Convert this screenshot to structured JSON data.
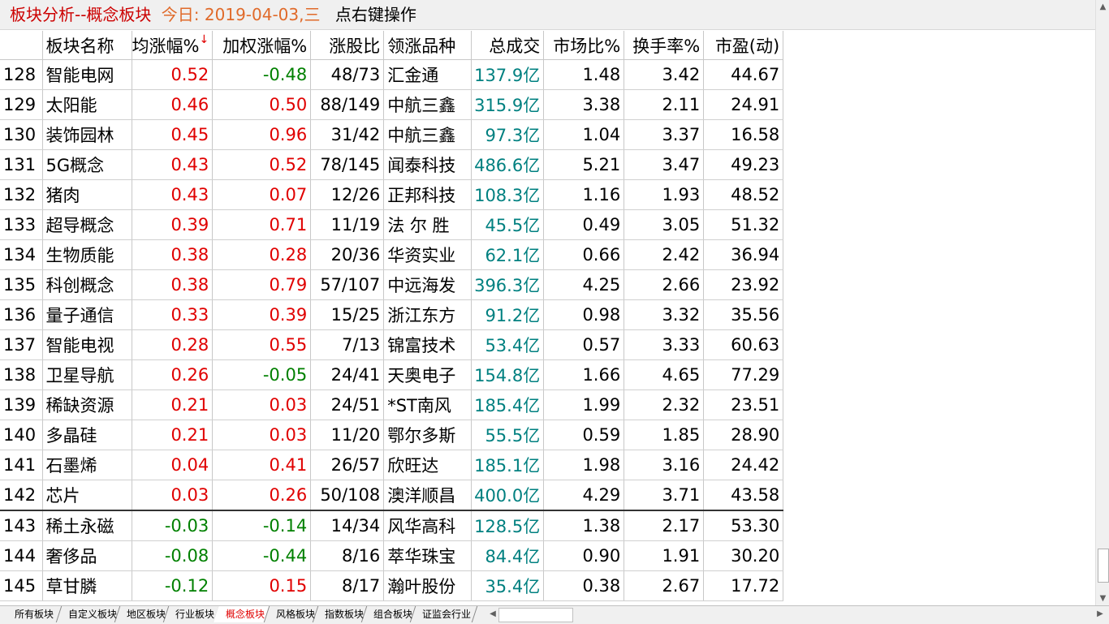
{
  "title": {
    "name": "板块分析--概念板块",
    "date": "今日: 2019-04-03,三",
    "hint": "点右键操作"
  },
  "columns": [
    "",
    "板块名称",
    "均涨幅%",
    "加权涨幅%",
    "涨股比",
    "领涨品种",
    "总成交",
    "市场比%",
    "换手率%",
    "市盈(动)"
  ],
  "sort_arrow": "↓",
  "rows": [
    {
      "idx": "128",
      "name": "智能电网",
      "avg": "0.52",
      "w": "-0.48",
      "ratio": "48/73",
      "lead": "汇金通",
      "vol": "137.9亿",
      "mkt": "1.48",
      "turn": "3.42",
      "pe": "44.67"
    },
    {
      "idx": "129",
      "name": "太阳能",
      "avg": "0.46",
      "w": "0.50",
      "ratio": "88/149",
      "lead": "中航三鑫",
      "vol": "315.9亿",
      "mkt": "3.38",
      "turn": "2.11",
      "pe": "24.91"
    },
    {
      "idx": "130",
      "name": "装饰园林",
      "avg": "0.45",
      "w": "0.96",
      "ratio": "31/42",
      "lead": "中航三鑫",
      "vol": "97.3亿",
      "mkt": "1.04",
      "turn": "3.37",
      "pe": "16.58"
    },
    {
      "idx": "131",
      "name": "5G概念",
      "avg": "0.43",
      "w": "0.52",
      "ratio": "78/145",
      "lead": "闻泰科技",
      "vol": "486.6亿",
      "mkt": "5.21",
      "turn": "3.47",
      "pe": "49.23"
    },
    {
      "idx": "132",
      "name": "猪肉",
      "avg": "0.43",
      "w": "0.07",
      "ratio": "12/26",
      "lead": "正邦科技",
      "vol": "108.3亿",
      "mkt": "1.16",
      "turn": "1.93",
      "pe": "48.52"
    },
    {
      "idx": "133",
      "name": "超导概念",
      "avg": "0.39",
      "w": "0.71",
      "ratio": "11/19",
      "lead": "法 尔 胜",
      "vol": "45.5亿",
      "mkt": "0.49",
      "turn": "3.05",
      "pe": "51.32"
    },
    {
      "idx": "134",
      "name": "生物质能",
      "avg": "0.38",
      "w": "0.28",
      "ratio": "20/36",
      "lead": "华资实业",
      "vol": "62.1亿",
      "mkt": "0.66",
      "turn": "2.42",
      "pe": "36.94"
    },
    {
      "idx": "135",
      "name": "科创概念",
      "avg": "0.38",
      "w": "0.79",
      "ratio": "57/107",
      "lead": "中远海发",
      "vol": "396.3亿",
      "mkt": "4.25",
      "turn": "2.66",
      "pe": "23.92"
    },
    {
      "idx": "136",
      "name": "量子通信",
      "avg": "0.33",
      "w": "0.39",
      "ratio": "15/25",
      "lead": "浙江东方",
      "vol": "91.2亿",
      "mkt": "0.98",
      "turn": "3.32",
      "pe": "35.56"
    },
    {
      "idx": "137",
      "name": "智能电视",
      "avg": "0.28",
      "w": "0.55",
      "ratio": "7/13",
      "lead": "锦富技术",
      "vol": "53.4亿",
      "mkt": "0.57",
      "turn": "3.33",
      "pe": "60.63"
    },
    {
      "idx": "138",
      "name": "卫星导航",
      "avg": "0.26",
      "w": "-0.05",
      "ratio": "24/41",
      "lead": "天奥电子",
      "vol": "154.8亿",
      "mkt": "1.66",
      "turn": "4.65",
      "pe": "77.29"
    },
    {
      "idx": "139",
      "name": "稀缺资源",
      "avg": "0.21",
      "w": "0.03",
      "ratio": "24/51",
      "lead": "*ST南风",
      "vol": "185.4亿",
      "mkt": "1.99",
      "turn": "2.32",
      "pe": "23.51"
    },
    {
      "idx": "140",
      "name": "多晶硅",
      "avg": "0.21",
      "w": "0.03",
      "ratio": "11/20",
      "lead": "鄂尔多斯",
      "vol": "55.5亿",
      "mkt": "0.59",
      "turn": "1.85",
      "pe": "28.90"
    },
    {
      "idx": "141",
      "name": "石墨烯",
      "avg": "0.04",
      "w": "0.41",
      "ratio": "26/57",
      "lead": "欣旺达",
      "vol": "185.1亿",
      "mkt": "1.98",
      "turn": "3.16",
      "pe": "24.42"
    },
    {
      "idx": "142",
      "name": "芯片",
      "avg": "0.03",
      "w": "0.26",
      "ratio": "50/108",
      "lead": "澳洋顺昌",
      "vol": "400.0亿",
      "mkt": "4.29",
      "turn": "3.71",
      "pe": "43.58"
    },
    {
      "idx": "143",
      "name": "稀土永磁",
      "avg": "-0.03",
      "w": "-0.14",
      "ratio": "14/34",
      "lead": "风华高科",
      "vol": "128.5亿",
      "mkt": "1.38",
      "turn": "2.17",
      "pe": "53.30"
    },
    {
      "idx": "144",
      "name": "奢侈品",
      "avg": "-0.08",
      "w": "-0.44",
      "ratio": "8/16",
      "lead": "萃华珠宝",
      "vol": "84.4亿",
      "mkt": "0.90",
      "turn": "1.91",
      "pe": "30.20"
    },
    {
      "idx": "145",
      "name": "草甘膦",
      "avg": "-0.12",
      "w": "0.15",
      "ratio": "8/17",
      "lead": "瀚叶股份",
      "vol": "35.4亿",
      "mkt": "0.38",
      "turn": "2.67",
      "pe": "17.72"
    }
  ],
  "tabs": [
    {
      "label": "所有板块",
      "active": false
    },
    {
      "label": "自定义板块",
      "active": false
    },
    {
      "label": "地区板块",
      "active": false
    },
    {
      "label": "行业板块",
      "active": false
    },
    {
      "label": "概念板块",
      "active": true
    },
    {
      "label": "风格板块",
      "active": false
    },
    {
      "label": "指数板块",
      "active": false
    },
    {
      "label": "组合板块",
      "active": false
    },
    {
      "label": "证监会行业",
      "active": false
    }
  ],
  "colors": {
    "up": "#e00000",
    "down": "#008000",
    "volume": "#008080",
    "title": "#cc0000",
    "date": "#e06a2a"
  },
  "icons": {
    "scroll_up": "triangle-up-icon",
    "scroll_down": "triangle-down-icon",
    "scroll_left": "triangle-left-icon",
    "scroll_right": "triangle-right-icon"
  }
}
